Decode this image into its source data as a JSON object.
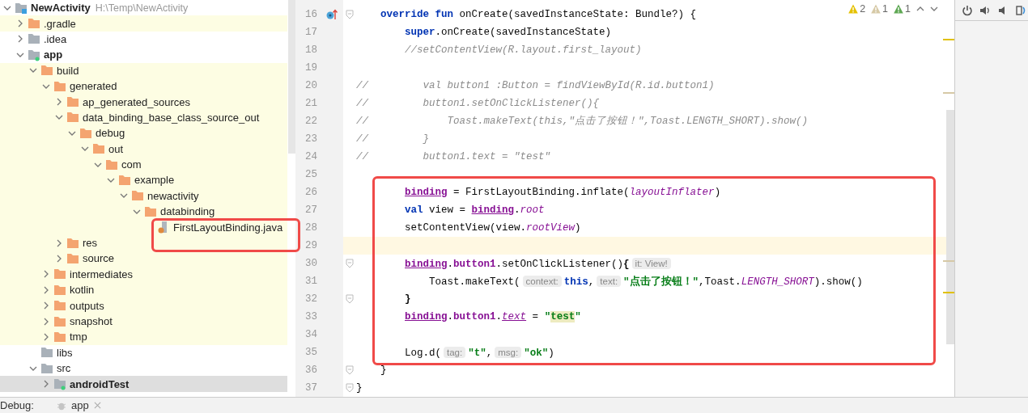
{
  "project_tree": {
    "root": {
      "name": "NewActivity",
      "path": "H:\\Temp\\NewActivity",
      "expanded": true,
      "selected": false,
      "children": [
        {
          "name": ".gradle",
          "kind": "folder",
          "excluded": true,
          "expanded": false,
          "selected": false
        },
        {
          "name": ".idea",
          "kind": "plain-folder",
          "excluded": false,
          "expanded": false,
          "selected": false
        },
        {
          "name": "app",
          "kind": "module",
          "bold": true,
          "excluded": false,
          "expanded": true,
          "selected": false,
          "children": [
            {
              "name": "build",
              "kind": "folder",
              "excluded": true,
              "expanded": true,
              "selected": false,
              "children": [
                {
                  "name": "generated",
                  "kind": "folder",
                  "excluded": true,
                  "expanded": true,
                  "selected": false,
                  "children": [
                    {
                      "name": "ap_generated_sources",
                      "kind": "folder",
                      "excluded": true,
                      "expanded": false,
                      "selected": false
                    },
                    {
                      "name": "data_binding_base_class_source_out",
                      "kind": "folder",
                      "excluded": true,
                      "expanded": true,
                      "selected": false,
                      "children": [
                        {
                          "name": "debug",
                          "kind": "folder",
                          "excluded": true,
                          "expanded": true,
                          "selected": false,
                          "children": [
                            {
                              "name": "out",
                              "kind": "folder",
                              "excluded": true,
                              "expanded": true,
                              "selected": false,
                              "children": [
                                {
                                  "name": "com",
                                  "kind": "folder",
                                  "excluded": true,
                                  "expanded": true,
                                  "selected": false,
                                  "children": [
                                    {
                                      "name": "example",
                                      "kind": "folder",
                                      "excluded": true,
                                      "expanded": true,
                                      "selected": false,
                                      "children": [
                                        {
                                          "name": "newactivity",
                                          "kind": "folder",
                                          "excluded": true,
                                          "expanded": true,
                                          "selected": false,
                                          "children": [
                                            {
                                              "name": "databinding",
                                              "kind": "folder",
                                              "excluded": true,
                                              "expanded": true,
                                              "selected": false,
                                              "children": [
                                                {
                                                  "name": "FirstLayoutBinding.java",
                                                  "kind": "java-file",
                                                  "excluded": true,
                                                  "selected": false
                                                }
                                              ]
                                            }
                                          ]
                                        }
                                      ]
                                    }
                                  ]
                                }
                              ]
                            }
                          ]
                        }
                      ]
                    },
                    {
                      "name": "res",
                      "kind": "folder",
                      "excluded": true,
                      "expanded": false,
                      "selected": false
                    },
                    {
                      "name": "source",
                      "kind": "folder",
                      "excluded": true,
                      "expanded": false,
                      "selected": false
                    }
                  ]
                },
                {
                  "name": "intermediates",
                  "kind": "folder",
                  "excluded": true,
                  "expanded": false,
                  "selected": false
                },
                {
                  "name": "kotlin",
                  "kind": "folder",
                  "excluded": true,
                  "expanded": false,
                  "selected": false
                },
                {
                  "name": "outputs",
                  "kind": "folder",
                  "excluded": true,
                  "expanded": false,
                  "selected": false
                },
                {
                  "name": "snapshot",
                  "kind": "folder",
                  "excluded": true,
                  "expanded": false,
                  "selected": false
                },
                {
                  "name": "tmp",
                  "kind": "folder",
                  "excluded": true,
                  "expanded": false,
                  "selected": false
                }
              ]
            },
            {
              "name": "libs",
              "kind": "plain-folder",
              "excluded": false,
              "selected": false
            },
            {
              "name": "src",
              "kind": "plain-folder",
              "excluded": false,
              "expanded": true,
              "selected": false,
              "children": [
                {
                  "name": "androidTest",
                  "kind": "module",
                  "bold": true,
                  "excluded": false,
                  "expanded": false,
                  "selected": true
                }
              ]
            }
          ]
        }
      ]
    }
  },
  "inspections": [
    {
      "count": "2",
      "color": "#e5c100"
    },
    {
      "count": "1",
      "color": "#d6c9a6"
    },
    {
      "count": "1",
      "color": "#5fa854"
    }
  ],
  "editor": {
    "lines": [
      {
        "number": "16",
        "overrides": true,
        "fold": true,
        "current": false,
        "tokens": [
          {
            "text": "    override fun",
            "kind": "keyword"
          },
          {
            "text": " onCreate(savedInstanceState: Bundle?) {"
          }
        ]
      },
      {
        "number": "17",
        "overrides": false,
        "fold": false,
        "current": false,
        "tokens": [
          {
            "text": "        super",
            "kind": "keyword"
          },
          {
            "text": ".onCreate(savedInstanceState)"
          }
        ]
      },
      {
        "number": "18",
        "overrides": false,
        "fold": false,
        "current": false,
        "tokens": [
          {
            "text": "        //setContentView(R.layout.first_layout)",
            "kind": "comment"
          }
        ]
      },
      {
        "number": "19",
        "overrides": false,
        "fold": false,
        "current": false
      },
      {
        "number": "20",
        "overrides": false,
        "fold": false,
        "current": false,
        "tokens": [
          {
            "text": "//         val button1 :Button = findViewById(R.id.button1)",
            "kind": "comment"
          }
        ]
      },
      {
        "number": "21",
        "overrides": false,
        "fold": false,
        "current": false,
        "tokens": [
          {
            "text": "//         button1.setOnClickListener(){",
            "kind": "comment"
          }
        ]
      },
      {
        "number": "22",
        "overrides": false,
        "fold": false,
        "current": false,
        "tokens": [
          {
            "text": "//             Toast.makeText(this,\"点击了按钮！\",Toast.LENGTH_SHORT).show()",
            "kind": "comment"
          }
        ]
      },
      {
        "number": "23",
        "overrides": false,
        "fold": false,
        "current": false,
        "tokens": [
          {
            "text": "//         }",
            "kind": "comment"
          }
        ]
      },
      {
        "number": "24",
        "overrides": false,
        "fold": false,
        "current": false,
        "tokens": [
          {
            "text": "//         button1.text = \"test\"",
            "kind": "comment"
          }
        ]
      },
      {
        "number": "25",
        "overrides": false,
        "fold": false,
        "current": false
      },
      {
        "number": "26",
        "overrides": false,
        "fold": false,
        "current": false,
        "tokens": [
          {
            "text": "        binding",
            "kind": "field",
            "underline": true
          },
          {
            "text": " = FirstLayoutBinding.inflate("
          },
          {
            "text": "layoutInflater",
            "kind": "property"
          },
          {
            "text": ")"
          }
        ]
      },
      {
        "number": "27",
        "overrides": false,
        "fold": false,
        "current": false,
        "tokens": [
          {
            "text": "        val",
            "kind": "keyword"
          },
          {
            "text": " view = "
          },
          {
            "text": "binding",
            "kind": "field",
            "underline": true
          },
          {
            "text": "."
          },
          {
            "text": "root",
            "kind": "property"
          }
        ]
      },
      {
        "number": "28",
        "overrides": false,
        "fold": false,
        "current": false,
        "tokens": [
          {
            "text": "        setContentView(view."
          },
          {
            "text": "rootView",
            "kind": "property"
          },
          {
            "text": ")"
          }
        ]
      },
      {
        "number": "29",
        "overrides": false,
        "fold": false,
        "current": true
      },
      {
        "number": "30",
        "overrides": false,
        "fold": true,
        "current": false,
        "tokens": [
          {
            "text": "        binding",
            "kind": "field",
            "underline": true
          },
          {
            "text": "."
          },
          {
            "text": "button1",
            "kind": "field"
          },
          {
            "text": ".setOnClickListener()"
          },
          {
            "text": "{",
            "kind": "brace"
          },
          {
            "text": "it: View!",
            "kind": "hint"
          }
        ]
      },
      {
        "number": "31",
        "overrides": false,
        "fold": false,
        "current": false,
        "tokens": [
          {
            "text": "            Toast.makeText("
          },
          {
            "text": "context:",
            "kind": "hint"
          },
          {
            "text": "this",
            "kind": "keyword"
          },
          {
            "text": ","
          },
          {
            "text": "text:",
            "kind": "hint"
          },
          {
            "text": "\"点击了按钮！\"",
            "kind": "string"
          },
          {
            "text": ",Toast."
          },
          {
            "text": "LENGTH_SHORT",
            "kind": "property"
          },
          {
            "text": ").show()"
          }
        ]
      },
      {
        "number": "32",
        "overrides": false,
        "fold": true,
        "current": false,
        "tokens": [
          {
            "text": "        }",
            "kind": "brace"
          }
        ]
      },
      {
        "number": "33",
        "overrides": false,
        "fold": false,
        "current": false,
        "tokens": [
          {
            "text": "        binding",
            "kind": "field",
            "underline": true
          },
          {
            "text": "."
          },
          {
            "text": "button1",
            "kind": "field"
          },
          {
            "text": "."
          },
          {
            "text": "text",
            "kind": "property",
            "underline": true
          },
          {
            "text": " = "
          },
          {
            "text": "\"",
            "kind": "string"
          },
          {
            "text": "test",
            "kind": "string",
            "highlight": true
          },
          {
            "text": "\"",
            "kind": "string"
          }
        ]
      },
      {
        "number": "34",
        "overrides": false,
        "fold": false,
        "current": false
      },
      {
        "number": "35",
        "overrides": false,
        "fold": false,
        "current": false,
        "tokens": [
          {
            "text": "        Log.d("
          },
          {
            "text": "tag:",
            "kind": "hint"
          },
          {
            "text": "\"t\"",
            "kind": "string"
          },
          {
            "text": ","
          },
          {
            "text": "msg:",
            "kind": "hint"
          },
          {
            "text": "\"ok\"",
            "kind": "string"
          },
          {
            "text": ")"
          }
        ]
      },
      {
        "number": "36",
        "overrides": false,
        "fold": true,
        "current": false,
        "tokens": [
          {
            "text": "    }"
          }
        ]
      },
      {
        "number": "37",
        "overrides": false,
        "fold": true,
        "current": false,
        "tokens": [
          {
            "text": "}"
          }
        ]
      }
    ]
  },
  "bottom_bar": {
    "label": "Debug:",
    "tab": "app"
  }
}
